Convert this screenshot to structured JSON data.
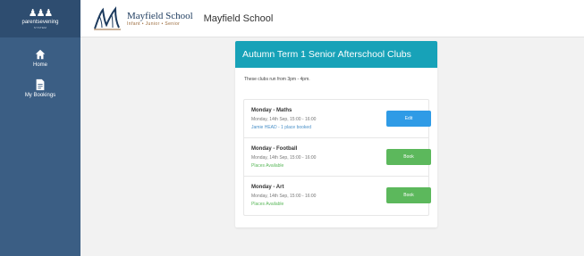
{
  "brand": {
    "name": "parentsevening",
    "subtitle": "SYSTEM"
  },
  "sidebar": {
    "items": [
      {
        "label": "Home",
        "icon": "home-icon"
      },
      {
        "label": "My Bookings",
        "icon": "document-icon"
      }
    ]
  },
  "header": {
    "logo_name": "Mayfield School",
    "logo_tagline": "Infant • Junior • Senior",
    "title": "Mayfield School"
  },
  "card": {
    "title": "Autumn Term 1 Senior Afterschool Clubs",
    "intro": "These clubs run from 3pm - 4pm.",
    "clubs": [
      {
        "title": "Monday - Maths",
        "when": "Monday, 14th Sep, 15:00 - 16:00",
        "status": "Jamie HEAD - 1 place booked",
        "button": "Edit"
      },
      {
        "title": "Monday - Football",
        "when": "Monday, 14th Sep, 15:00 - 16:00",
        "status": "Places Available",
        "button": "Book"
      },
      {
        "title": "Monday - Art",
        "when": "Monday, 14th Sep, 15:00 - 16:00",
        "status": "Places Available",
        "button": "Book"
      }
    ]
  },
  "colors": {
    "sidebar": "#3b5e84",
    "header_accent": "#17a2b8",
    "edit_button": "#2f9be6",
    "book_button": "#5cb85c"
  }
}
